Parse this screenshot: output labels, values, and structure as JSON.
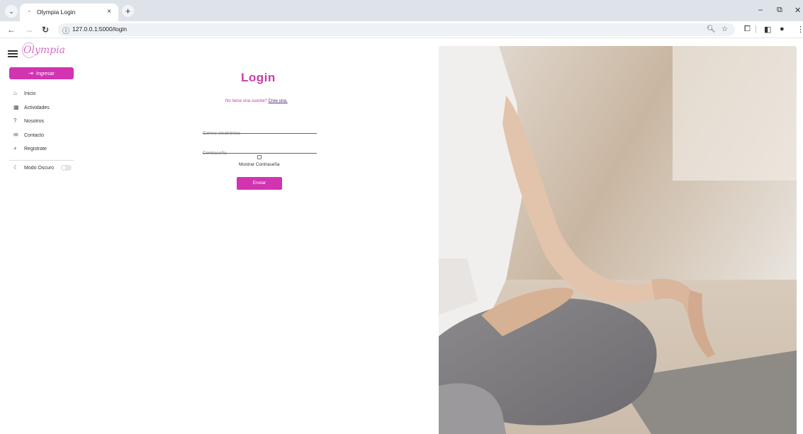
{
  "browser": {
    "tab_title": "Olympia Login",
    "tab_close": "×",
    "new_tab": "+",
    "url": "127.0.0.1:5000/login",
    "win_min": "–",
    "win_restore": "⧉",
    "win_close": "✕"
  },
  "sidebar": {
    "logo": "Olympia",
    "login_button": "Ingresar",
    "items": [
      {
        "label": "Inicio",
        "icon": "home-icon"
      },
      {
        "label": "Actividades",
        "icon": "calendar-icon"
      },
      {
        "label": "Nosotros",
        "icon": "question-icon"
      },
      {
        "label": "Contacto",
        "icon": "mail-icon"
      },
      {
        "label": "Registrate",
        "icon": "plus-icon"
      }
    ],
    "dark_mode": "Modo Oscuro"
  },
  "login": {
    "title": "Login",
    "signup_text": "No tiene una cuenta? ",
    "signup_link": "Cree una.",
    "email_placeholder": "Correo electrónico",
    "password_placeholder": "Contraseña",
    "show_password": "Mostrar Contraseña",
    "submit": "Enviar"
  },
  "colors": {
    "accent": "#d234b1",
    "title": "#c93ea8"
  }
}
